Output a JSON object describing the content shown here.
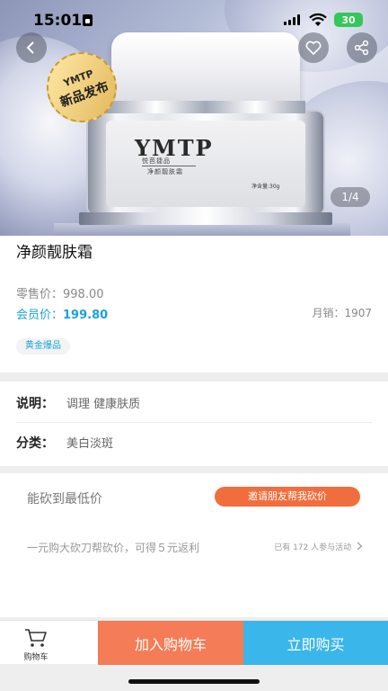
{
  "status_bar": {
    "time": "15:01",
    "battery": "30"
  },
  "hero": {
    "badge_line1": "YMTP",
    "badge_line2": "新品发布",
    "brand": "YMTP",
    "brand_sub": "悦芭捷品",
    "product_on_jar": "净颜靓肤霜",
    "net_content": "净含量:30g",
    "pager": "1/4"
  },
  "product": {
    "title": "净颜靓肤霜",
    "retail_label": "零售价：",
    "retail_price": "998.00",
    "member_label": "会员价：",
    "member_price": "199.80",
    "sales_label": "月销：",
    "sales_count": "1907",
    "tag": "黄金爆品"
  },
  "details": {
    "desc_label": "说明：",
    "desc_value": "调理   健康肤质",
    "category_label": "分类：",
    "category_value": "美白淡斑"
  },
  "bargain": {
    "title": "能砍到最低价",
    "invite_button": "邀请朋友帮我砍价",
    "description": "一元购大砍刀帮砍价，可得５元返利",
    "participants": "已有 172 人参与活动"
  },
  "bottom_bar": {
    "cart_label": "购物车",
    "add_to_cart": "加入购物车",
    "buy_now": "立即购买"
  },
  "colors": {
    "member_blue": "#1aa2de",
    "invite_orange": "#f26d3d",
    "add_cart_orange": "#f47c57",
    "buy_blue": "#3ab6ea"
  }
}
